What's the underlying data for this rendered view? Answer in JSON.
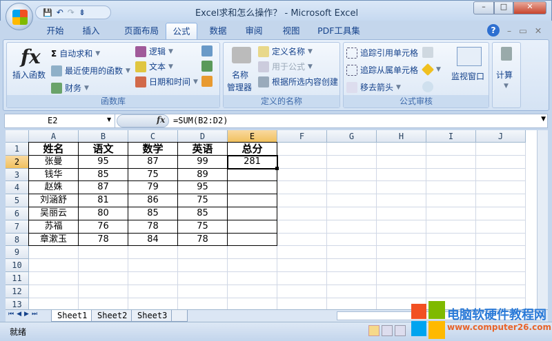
{
  "window": {
    "title": "Excel求和怎么操作？ - Microsoft Excel",
    "minimize": "–",
    "restore": "□",
    "close": "✕"
  },
  "qat": {
    "save": "💾",
    "undo": "↶",
    "redo": "↷",
    "more": "⇟"
  },
  "tabs": [
    "开始",
    "插入",
    "页面布局",
    "公式",
    "数据",
    "审阅",
    "视图",
    "PDF工具集"
  ],
  "active_tab": "公式",
  "ribbon_right": {
    "help": "?",
    "min": "–",
    "restore": "▭",
    "close": "✕"
  },
  "ribbon": {
    "function_library": {
      "label": "函数库",
      "insert_function": "插入函数",
      "fx": "fx",
      "autosum": "自动求和",
      "recent": "最近使用的函数",
      "financial": "财务",
      "logical": "逻辑",
      "text": "文本",
      "datetime": "日期和时间"
    },
    "defined_names": {
      "label": "定义的名称",
      "name_manager_1": "名称",
      "name_manager_2": "管理器",
      "define_name": "定义名称",
      "use_in_formula": "用于公式",
      "create_from_selection": "根据所选内容创建"
    },
    "formula_auditing": {
      "label": "公式审核",
      "trace_precedents": "追踪引用单元格",
      "trace_dependents": "追踪从属单元格",
      "remove_arrows": "移去箭头",
      "watch_window": "监视窗口"
    },
    "calculation": {
      "label": "计算"
    }
  },
  "formula_bar": {
    "name_box": "E2",
    "fx": "fx",
    "formula": "=SUM(B2:D2)"
  },
  "columns": [
    "A",
    "B",
    "C",
    "D",
    "E",
    "F",
    "G",
    "H",
    "I",
    "J"
  ],
  "rows": [
    "1",
    "2",
    "3",
    "4",
    "5",
    "6",
    "7",
    "8",
    "9",
    "10",
    "11",
    "12",
    "13"
  ],
  "selected": {
    "column": "E",
    "row": "2"
  },
  "table": [
    [
      "姓名",
      "语文",
      "数学",
      "英语",
      "总分"
    ],
    [
      "张曼",
      "95",
      "87",
      "99",
      "281"
    ],
    [
      "钱华",
      "85",
      "75",
      "89",
      ""
    ],
    [
      "赵姝",
      "87",
      "79",
      "95",
      ""
    ],
    [
      "刘涵舒",
      "81",
      "86",
      "75",
      ""
    ],
    [
      "吴丽云",
      "80",
      "85",
      "85",
      ""
    ],
    [
      "苏福",
      "76",
      "78",
      "75",
      ""
    ],
    [
      "章漱玉",
      "78",
      "84",
      "78",
      ""
    ]
  ],
  "sheets": [
    "Sheet1",
    "Sheet2",
    "Sheet3"
  ],
  "active_sheet": "Sheet1",
  "status": {
    "ready": "就绪"
  },
  "watermark": {
    "site_name": "电脑软硬件教程网",
    "url": "www.computer26.com"
  }
}
